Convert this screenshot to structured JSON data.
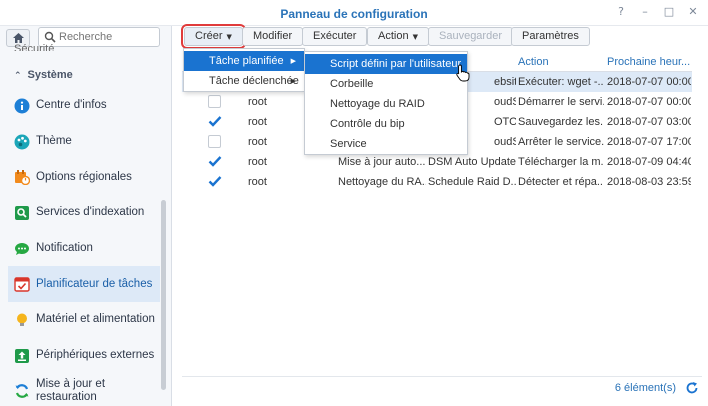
{
  "window": {
    "title": "Panneau de configuration",
    "buttons": [
      "?",
      "–",
      "□",
      "✕"
    ]
  },
  "sidebar": {
    "search_placeholder": "Recherche",
    "cut_item": "Sécurité",
    "section": "Système",
    "items": [
      {
        "label": "Centre d'infos",
        "icon": "info-icon"
      },
      {
        "label": "Thème",
        "icon": "palette-icon"
      },
      {
        "label": "Options régionales",
        "icon": "regional-options-icon"
      },
      {
        "label": "Services d'indexation",
        "icon": "indexing-icon"
      },
      {
        "label": "Notification",
        "icon": "notification-icon"
      },
      {
        "label": "Planificateur de tâches",
        "icon": "task-scheduler-icon"
      },
      {
        "label": "Matériel et alimentation",
        "icon": "bulb-icon"
      },
      {
        "label": "Périphériques externes",
        "icon": "external-devices-icon"
      },
      {
        "label": "Mise à jour et restauration",
        "icon": "update-restore-icon"
      }
    ]
  },
  "toolbar": {
    "create": "Créer",
    "edit": "Modifier",
    "run": "Exécuter",
    "action": "Action",
    "save": "Sauvegarder",
    "settings": "Paramètres"
  },
  "table": {
    "headers": {
      "action": "Action",
      "next": "Prochaine heur..."
    },
    "rows": [
      {
        "checked": false,
        "user": "",
        "task": "",
        "type": "ebsite",
        "action": "Exécuter: wget -...",
        "next": "2018-07-07 00:00"
      },
      {
        "checked": false,
        "user": "root",
        "task": "",
        "type": "oudSync",
        "action": "Démarrer le servi...",
        "next": "2018-07-07 00:00"
      },
      {
        "checked": true,
        "user": "root",
        "task": "",
        "type": "OTOS",
        "action": "Sauvegardez les...",
        "next": "2018-07-07 03:00"
      },
      {
        "checked": false,
        "user": "root",
        "task": "",
        "type": "oudSync",
        "action": "Arrêter le service...",
        "next": "2018-07-07 17:00"
      },
      {
        "checked": true,
        "user": "root",
        "task": "Mise à jour auto...",
        "type": "DSM Auto Update",
        "action": "Télécharger la m...",
        "next": "2018-07-09 04:40"
      },
      {
        "checked": true,
        "user": "root",
        "task": "Nettoyage du RA...",
        "type": "Schedule Raid D...",
        "action": "Détecter et répa...",
        "next": "2018-08-03 23:59"
      }
    ]
  },
  "footer": {
    "count": "6 élément(s)"
  },
  "menu_create": {
    "items": [
      "Tâche planifiée",
      "Tâche déclenchée"
    ]
  },
  "menu_scheduled": {
    "items": [
      "Script défini par l'utilisateur",
      "Corbeille",
      "Nettoyage du RAID",
      "Contrôle du bip",
      "Service"
    ]
  },
  "colors": {
    "accent": "#1a73d0",
    "title": "#2a73b8",
    "highlight_outline": "#e03b3b"
  }
}
